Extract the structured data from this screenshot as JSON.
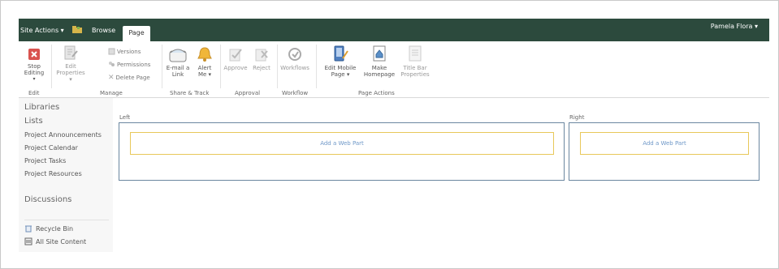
{
  "topbar": {
    "site_actions": "Site Actions ▾",
    "tab_browse": "Browse",
    "tab_page": "Page",
    "user": "Pamela Flora ▾"
  },
  "ribbon": {
    "stop_editing": "Stop Editing",
    "edit_properties": [
      "Edit",
      "Properties ▾"
    ],
    "versions": "Versions",
    "permissions": "Permissions",
    "delete_page": "Delete Page",
    "email_link": [
      "E-mail a",
      "Link"
    ],
    "alert_me": [
      "Alert",
      "Me ▾"
    ],
    "approve": "Approve",
    "reject": "Reject",
    "workflows": "Workflows",
    "edit_mobile_page": [
      "Edit Mobile",
      "Page ▾"
    ],
    "make_homepage": [
      "Make",
      "Homepage"
    ],
    "title_bar_properties": [
      "Title Bar",
      "Properties"
    ],
    "groups": {
      "edit": "Edit",
      "manage": "Manage",
      "share_track": "Share & Track",
      "approval": "Approval",
      "workflow": "Workflow",
      "page_actions": "Page Actions"
    }
  },
  "nav": {
    "libraries": "Libraries",
    "lists": "Lists",
    "items": [
      "Project Announcements",
      "Project Calendar",
      "Project Tasks",
      "Project Resources"
    ],
    "discussions": "Discussions",
    "recycle_bin": "Recycle Bin",
    "all_site_content": "All Site Content"
  },
  "zones": {
    "left_label": "Left",
    "right_label": "Right",
    "add_web_part": "Add a Web Part"
  },
  "colors": {
    "topbar": "#2c4a3d",
    "zone_border": "#6b87a0",
    "webpart_border": "#e8c85a",
    "link": "#6f98c8"
  }
}
